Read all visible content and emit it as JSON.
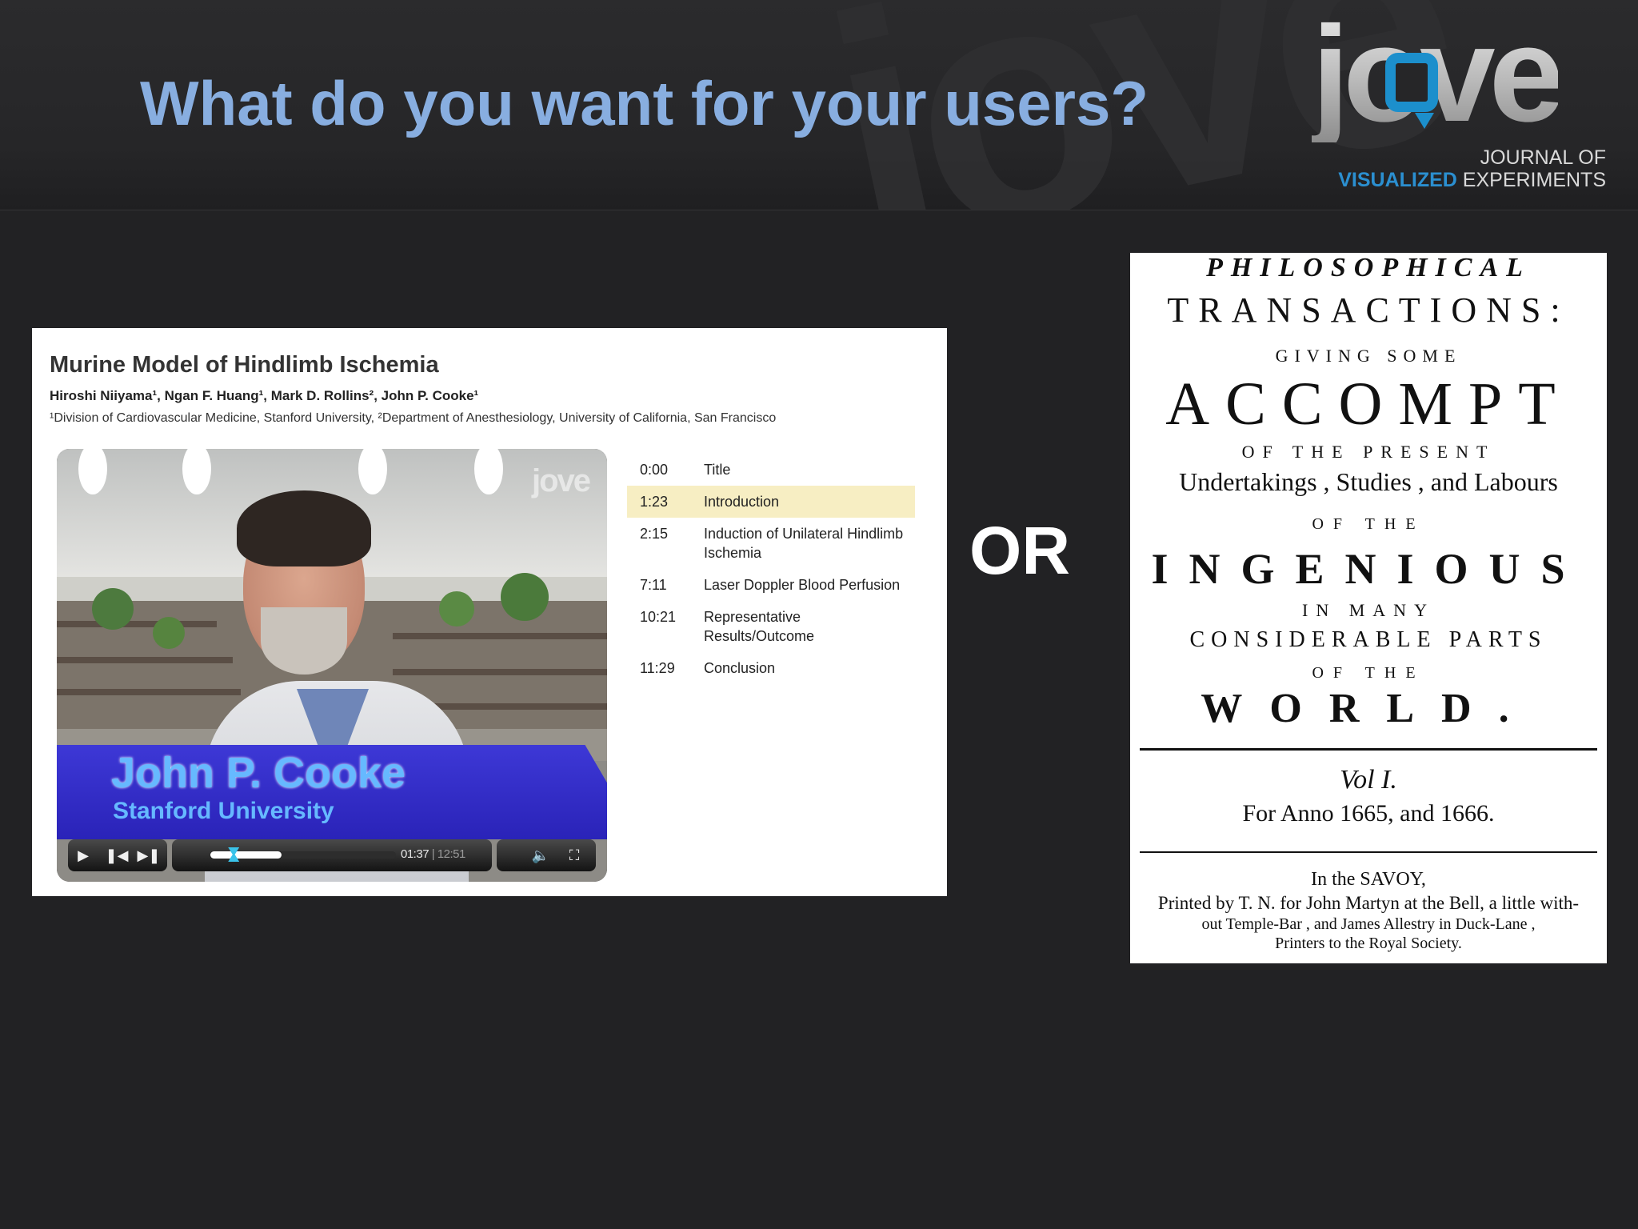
{
  "slide": {
    "title": "What do you want for your users?",
    "or_label": "OR",
    "title_color": "#88aee0"
  },
  "logo": {
    "wordmark": "jove",
    "line1": "JOURNAL OF",
    "line2_accent": "VISUALIZED",
    "line2_rest": "EXPERIMENTS",
    "accent_color": "#2b8fd0"
  },
  "video_page": {
    "title": "Murine Model of Hindlimb Ischemia",
    "authors": "Hiroshi Niiyama¹, Ngan F. Huang¹, Mark D. Rollins², John P. Cooke¹",
    "affiliations": "¹Division of Cardiovascular Medicine, Stanford University, ²Department of Anesthesiology, University of California, San Francisco",
    "player": {
      "watermark": "jove",
      "lower_third_name": "John P. Cooke",
      "lower_third_org": "Stanford University",
      "current_time": "01:37",
      "total_time": "12:51",
      "progress_fraction": 0.126,
      "icons": {
        "play": "play-icon",
        "prev": "previous-chapter-icon",
        "next": "next-chapter-icon",
        "volume": "volume-icon",
        "fullscreen": "fullscreen-icon"
      }
    },
    "chapters": [
      {
        "time": "0:00",
        "label": "Title",
        "active": false
      },
      {
        "time": "1:23",
        "label": "Introduction",
        "active": true
      },
      {
        "time": "2:15",
        "label": "Induction of Unilateral Hindlimb Ischemia",
        "active": false
      },
      {
        "time": "7:11",
        "label": "Laser Doppler Blood Perfusion",
        "active": false
      },
      {
        "time": "10:21",
        "label": "Representative Results/Outcome",
        "active": false
      },
      {
        "time": "11:29",
        "label": "Conclusion",
        "active": false
      }
    ]
  },
  "title_page": {
    "line1": "PHILOSOPHICAL",
    "line2": "TRANSACTIONS:",
    "line3": "GIVING SOME",
    "line4": "ACCOMPT",
    "line5": "OF THE PRESENT",
    "line6": "Undertakings , Studies , and Labours",
    "line7": "OF THE",
    "line8": "INGENIOUS",
    "line9": "IN MANY",
    "line10": "CONSIDERABLE PARTS",
    "line11": "OF THE",
    "line12": "WORLD.",
    "volume": "Vol I.",
    "years": "For Anno 1665, and 1666.",
    "imprint1": "In the SAVOY,",
    "imprint2": "Printed by T. N. for John Martyn at the Bell, a little with-",
    "imprint3": "out Temple-Bar , and James Allestry in Duck-Lane ,",
    "imprint4": "Printers to the Royal Society."
  }
}
